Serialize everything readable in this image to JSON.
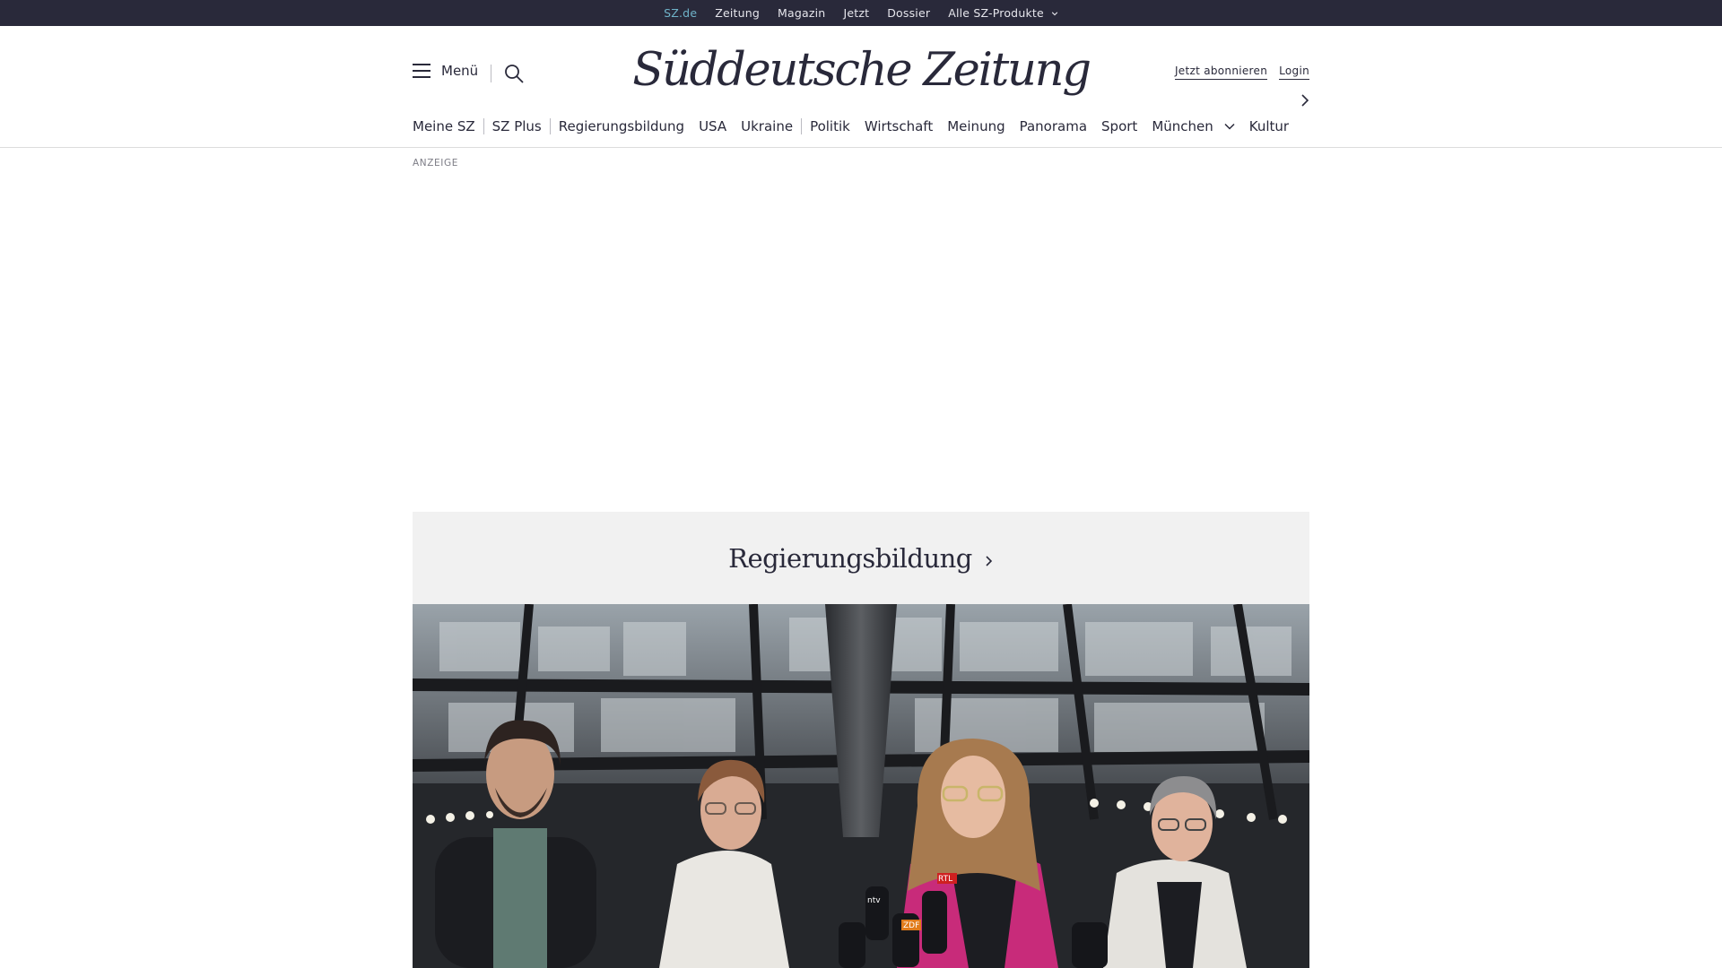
{
  "topbar": {
    "items": [
      {
        "label": "SZ.de",
        "active": true
      },
      {
        "label": "Zeitung"
      },
      {
        "label": "Magazin"
      },
      {
        "label": "Jetzt"
      },
      {
        "label": "Dossier"
      },
      {
        "label": "Alle SZ-Produkte",
        "dropdown": true
      }
    ]
  },
  "header": {
    "menu_label": "Menü",
    "logo_text": "Süddeutsche Zeitung",
    "subscribe_label": "Jetzt abonnieren",
    "login_label": "Login"
  },
  "nav": {
    "items": [
      "Meine SZ",
      "SZ Plus",
      "Regierungsbildung",
      "USA",
      "Ukraine",
      "Politik",
      "Wirtschaft",
      "Meinung",
      "Panorama",
      "Sport",
      "München",
      "Kultur"
    ]
  },
  "ad": {
    "label": "ANZEIGE"
  },
  "section": {
    "title": "Regierungsbildung"
  },
  "hero": {
    "mic_labels": [
      "ntv",
      "RTL",
      "ZDF"
    ]
  },
  "colors": {
    "topbar_bg": "#29293a",
    "topbar_active": "#6fb3c9",
    "text": "#29293a",
    "section_bg": "#f1f1f1"
  },
  "icons": [
    "hamburger-icon",
    "search-icon",
    "chevron-down-icon",
    "chevron-right-icon"
  ]
}
